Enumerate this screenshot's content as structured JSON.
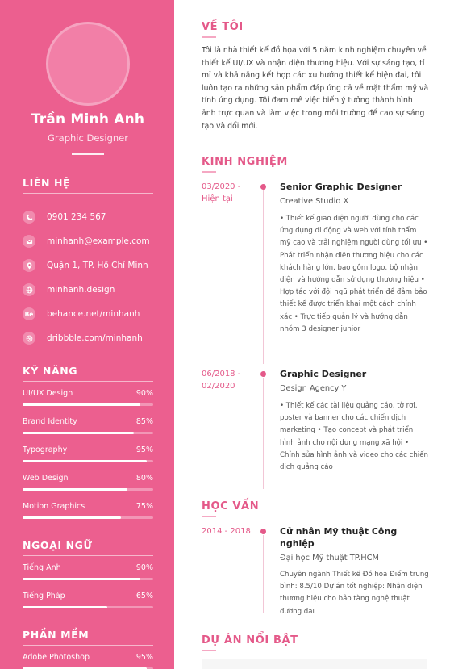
{
  "profile": {
    "name": "Trần Minh Anh",
    "role": "Graphic Designer"
  },
  "contact": {
    "title": "LIÊN HỆ",
    "items": [
      {
        "icon": "phone-icon",
        "text": "0901 234 567"
      },
      {
        "icon": "mail-icon",
        "text": "minhanh@example.com"
      },
      {
        "icon": "location-icon",
        "text": "Quận 1, TP. Hồ Chí Minh"
      },
      {
        "icon": "globe-icon",
        "text": "minhanh.design"
      },
      {
        "icon": "behance-icon",
        "glyph": "Bē",
        "text": "behance.net/minhanh"
      },
      {
        "icon": "dribbble-icon",
        "text": "dribbble.com/minhanh"
      }
    ]
  },
  "skills": {
    "title": "KỸ NĂNG",
    "items": [
      {
        "name": "UI/UX Design",
        "percent_label": "90%",
        "level": 0.9
      },
      {
        "name": "Brand Identity",
        "percent_label": "85%",
        "level": 0.85
      },
      {
        "name": "Typography",
        "percent_label": "95%",
        "level": 0.95
      },
      {
        "name": "Web Design",
        "percent_label": "80%",
        "level": 0.8
      },
      {
        "name": "Motion Graphics",
        "percent_label": "75%",
        "level": 0.75
      }
    ]
  },
  "languages": {
    "title": "NGOẠI NGỮ",
    "items": [
      {
        "name": "Tiếng Anh",
        "percent_label": "90%",
        "level": 0.9
      },
      {
        "name": "Tiếng Pháp",
        "percent_label": "65%",
        "level": 0.65
      }
    ]
  },
  "software": {
    "title": "PHẦN MỀM",
    "items": [
      {
        "name": "Adobe Photoshop",
        "percent_label": "95%",
        "level": 0.95
      }
    ]
  },
  "about": {
    "title": "VỀ TÔI",
    "text": "Tôi là nhà thiết kế đồ họa với 5 năm kinh nghiệm chuyên về thiết kế UI/UX và nhận diện thương hiệu. Với sự sáng tạo, tỉ mỉ và khả năng kết hợp các xu hướng thiết kế hiện đại, tôi luôn tạo ra những sản phẩm đáp ứng cả về mặt thẩm mỹ và tính ứng dụng. Tôi đam mê việc biến ý tưởng thành hình ảnh trực quan và làm việc trong môi trường để cao sự sáng tạo và đổi mới."
  },
  "experience": {
    "title": "KINH NGHIỆM",
    "items": [
      {
        "date": "03/2020 - Hiện tại",
        "title": "Senior Graphic Designer",
        "company": "Creative Studio X",
        "desc": "• Thiết kế giao diện người dùng cho các ứng dụng di động và web với tính thẩm mỹ cao và trải nghiệm người dùng tối ưu • Phát triển nhận diện thương hiệu cho các khách hàng lớn, bao gồm logo, bộ nhận diện và hướng dẫn sử dụng thương hiệu • Hợp tác với đội ngũ phát triển để đảm bảo thiết kế được triển khai một cách chính xác • Trực tiếp quản lý và hướng dẫn nhóm 3 designer junior"
      },
      {
        "date": "06/2018 - 02/2020",
        "title": "Graphic Designer",
        "company": "Design Agency Y",
        "desc": "• Thiết kế các tài liệu quảng cáo, tờ rơi, poster và banner cho các chiến dịch marketing • Tạo concept và phát triển hình ảnh cho nội dung mạng xã hội • Chỉnh sửa hình ảnh và video cho các chiến dịch quảng cáo"
      }
    ]
  },
  "education": {
    "title": "HỌC VẤN",
    "items": [
      {
        "date": "2014 - 2018",
        "title": "Cử nhân Mỹ thuật Công nghiệp",
        "school": "Đại học Mỹ thuật TP.HCM",
        "desc": "Chuyên ngành Thiết kế Đồ họa Điểm trung bình: 8.5/10 Dự án tốt nghiệp: Nhận diện thương hiệu cho bảo tàng nghệ thuật đương đại"
      }
    ]
  },
  "projects": {
    "title": "DỰ ÁN NỔI BẬT"
  },
  "colors": {
    "sidebar": "#ec5f8f",
    "accent": "#e45989",
    "accent_light": "#f5a8c3"
  }
}
